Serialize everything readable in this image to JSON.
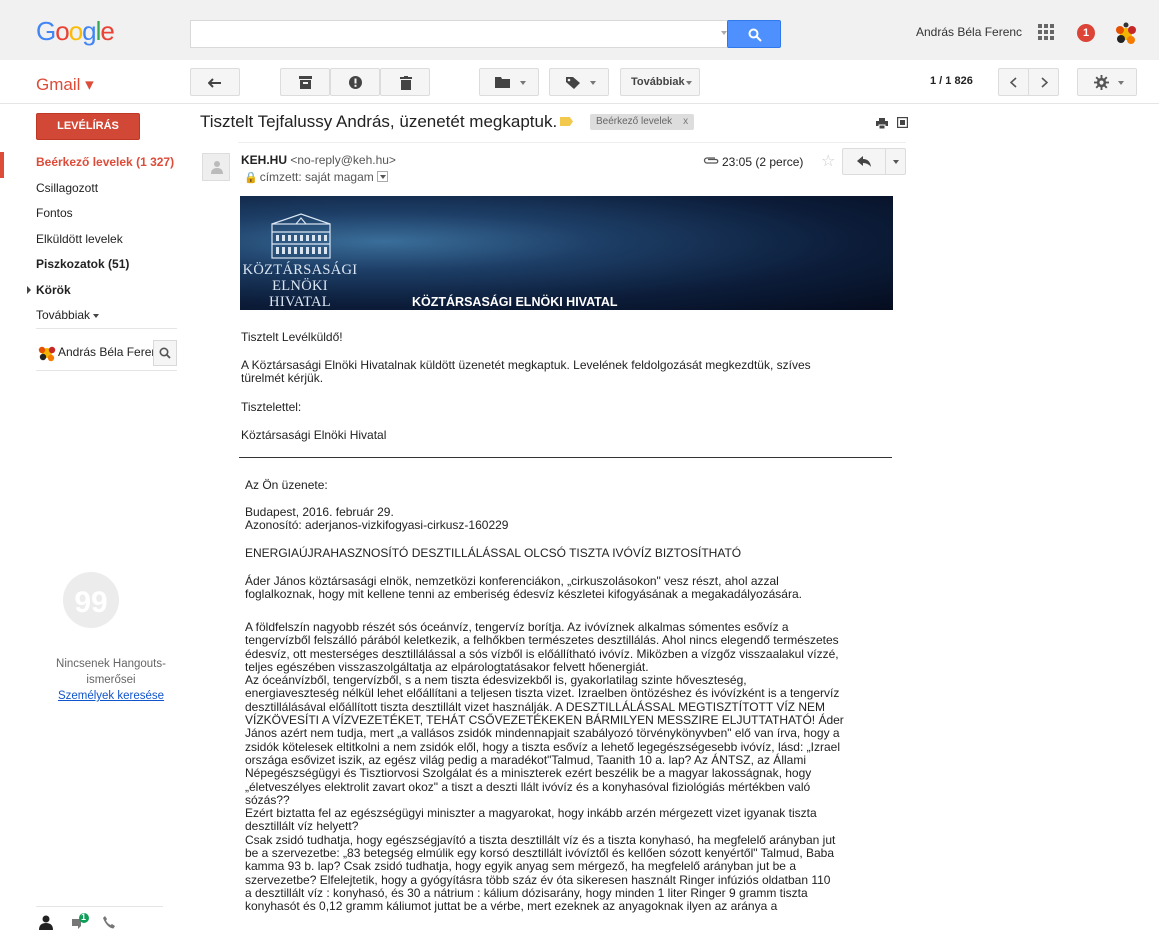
{
  "topbar": {
    "logo": "Google",
    "logo_colors": [
      "#4285f4",
      "#ea4335",
      "#fbbc05",
      "#4285f4",
      "#34a853",
      "#ea4335"
    ],
    "search_value": "",
    "username": "András Béla Ferenc",
    "notifications": "1"
  },
  "subbar": {
    "gmail_label": "Gmail ▾",
    "more_label": "Továbbiak",
    "page_count": "1 / 1 826"
  },
  "sidebar": {
    "compose": "LEVÉLÍRÁS",
    "items": [
      {
        "label": "Beérkező levelek (1 327)"
      },
      {
        "label": "Csillagozott"
      },
      {
        "label": "Fontos"
      },
      {
        "label": "Elküldött levelek"
      },
      {
        "label": "Piszkozatok (51)"
      },
      {
        "label": "Körök"
      },
      {
        "label": "Továbbiak"
      }
    ],
    "hangout_user": "András Béla Ferenc",
    "no_contacts": "Nincsenek Hangouts-ismerősei",
    "find_people": "Személyek keresése",
    "bottom_badge": "1"
  },
  "message": {
    "subject": "Tisztelt Tejfalussy András, üzenetét megkaptuk.",
    "label_chip": "Beérkező levelek",
    "label_chip_close": "x",
    "sender_name": "KEH.HU",
    "sender_email": "<no-reply@keh.hu>",
    "recipient": "címzett: saját magam",
    "time": "23:05 (2 perce)",
    "banner_name_line1": "KÖZTÁRSASÁGI",
    "banner_name_line2": "ELNÖKI HIVATAL",
    "banner_title": "KÖZTÁRSASÁGI ELNÖKI HIVATAL",
    "greeting": "Tisztelt Levélküldő!",
    "body1_line1": "A Köztársasági Elnöki Hivatalnak küldött üzenetét megkaptuk. Levelének feldolgozását megkezdtük, szíves",
    "body1_line2": "türelmét kérjük.",
    "closing": "Tisztelettel:",
    "signature": "Köztársasági Elnöki Hivatal",
    "your_message": "Az Ön üzenete:",
    "date_line": "Budapest, 2016. február 29.",
    "id_line": "Azonosító: aderjanos-vizkifogyasi-cirkusz-160229",
    "headline": "ENERGIAÚJRAHASZNOSÍTÓ DESZTILLÁLÁSSAL OLCSÓ TISZTA IVÓVÍZ BIZTOSÍTHATÓ",
    "para1_line1": "Áder János köztársasági elnök, nemzetközi konferenciákon, „cirkuszolásokon\" vesz részt, ahol azzal",
    "para1_line2": "foglalkoznak, hogy mit kellene tenni az emberiség édesvíz készletei kifogyásának a megakadályozására.",
    "long_text": "A földfelszín nagyobb részét sós óceánvíz, tengervíz borítja. Az ivóvíznek alkalmas sómentes esővíz a\ntengervízből felszálló párából keletkezik, a felhőkben természetes desztillálás. Ahol nincs elegendő természetes\nédesvíz, ott mesterséges desztillálással a sós vízből is előállítható ivóvíz. Miközben a vízgőz visszaalakul vízzé,\nteljes egészében visszaszolgáltatja az elpárologtatásakor felvett hőenergiát.\nAz óceánvízből, tengervízből, s a nem tiszta édesvizekből is, gyakorlatilag szinte hőveszteség,\nenergiaveszteség nélkül lehet előállítani a teljesen tiszta vizet. Izraelben öntözéshez és ivóvízként is a tengervíz\ndesztillálásával előállított tiszta desztillált vizet használják. A DESZTILLÁLÁSSAL MEGTISZTÍTOTT VÍZ NEM\nVÍZKÖVESÍTI A VÍZVEZETÉKET, TEHÁT CSŐVEZETÉKEKEN BÁRMILYEN MESSZIRE ELJUTTATHATÓ! Áder\nJános azért nem tudja, mert „a vallásos zsidók mindennapjait szabályozó törvénykönyvben\" elő van írva, hogy a\nzsidók kötelesek eltitkolni a nem zsidók elől, hogy a tiszta esővíz a lehető legegészségesebb ivóvíz, lásd: „Izrael\nországa esővizet iszik, az egész világ pedig a maradékot\"Talmud, Taanith 10 a. lap? Az ÁNTSZ, az Állami\nNépegészségügyi és Tisztiorvosi Szolgálat és a miniszterek ezért beszélik be a magyar lakosságnak, hogy\n„életveszélyes elektrolit zavart okoz\" a tiszt a deszti llált ivóvíz és a konyhasóval fiziológiás mértékben való\nsózás??\nEzért biztatta fel az egészségügyi miniszter a magyarokat, hogy inkább arzén mérgezett vizet igyanak tiszta\ndesztillált víz helyett?\nCsak zsidó tudhatja, hogy egészségjavító a tiszta desztillált víz és a tiszta konyhasó, ha megfelelő arányban jut\nbe a szervezetbe: „83 betegség elmúlik egy korsó desztillált ivóvíztől és kellően sózott kenyértől\" Talmud, Baba\nkamma 93 b. lap? Csak zsidó tudhatja, hogy egyik anyag sem mérgező, ha megfelelő arányban jut be a\nszervezetbe? Elfelejtetik, hogy a gyógyításra több száz év óta sikeresen használt Ringer infúziós oldatban 110\na desztillált víz : konyhasó, és 30 a nátrium : kálium dózisarány, hogy minden 1 liter Ringer 9 gramm tiszta\nkonyhasót és 0,12 gramm káliumot juttat be a vérbe, mert ezeknek az anyagoknak ilyen az aránya a"
  }
}
